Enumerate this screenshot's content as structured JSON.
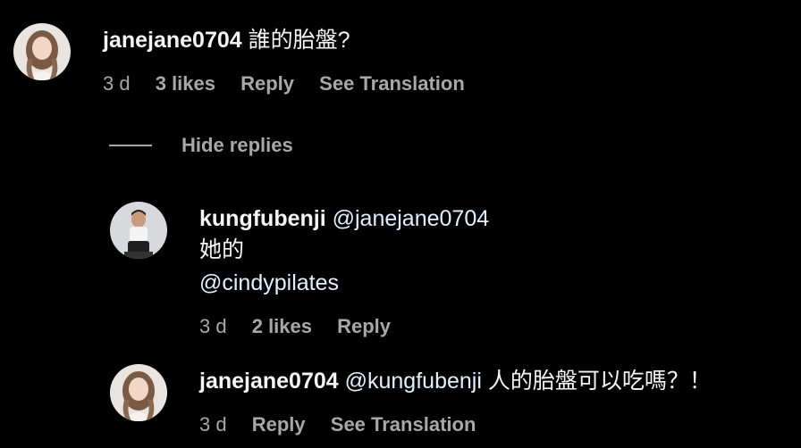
{
  "comments": [
    {
      "username": "janejane0704",
      "text": "誰的胎盤?",
      "time": "3 d",
      "likes": "3 likes",
      "reply": "Reply",
      "translate": "See Translation"
    }
  ],
  "hide_replies_label": "Hide replies",
  "replies": [
    {
      "username": "kungfubenji",
      "mention": "@janejane0704",
      "line2": "她的",
      "line3": "@cindypilates",
      "time": "3 d",
      "likes": "2 likes",
      "reply": "Reply"
    },
    {
      "username": "janejane0704",
      "mention": "@kungfubenji",
      "text": "人的胎盤可以吃嗎？！",
      "time": "3 d",
      "reply": "Reply",
      "translate": "See Translation"
    }
  ],
  "colors": {
    "background": "#000000",
    "primary_text": "#f5f5f5",
    "secondary_text": "#a8a8a8",
    "mention": "#e0f1ff"
  },
  "icons": {
    "avatar_1": "woman-avatar",
    "avatar_2": "man-avatar",
    "avatar_3": "woman-avatar"
  }
}
